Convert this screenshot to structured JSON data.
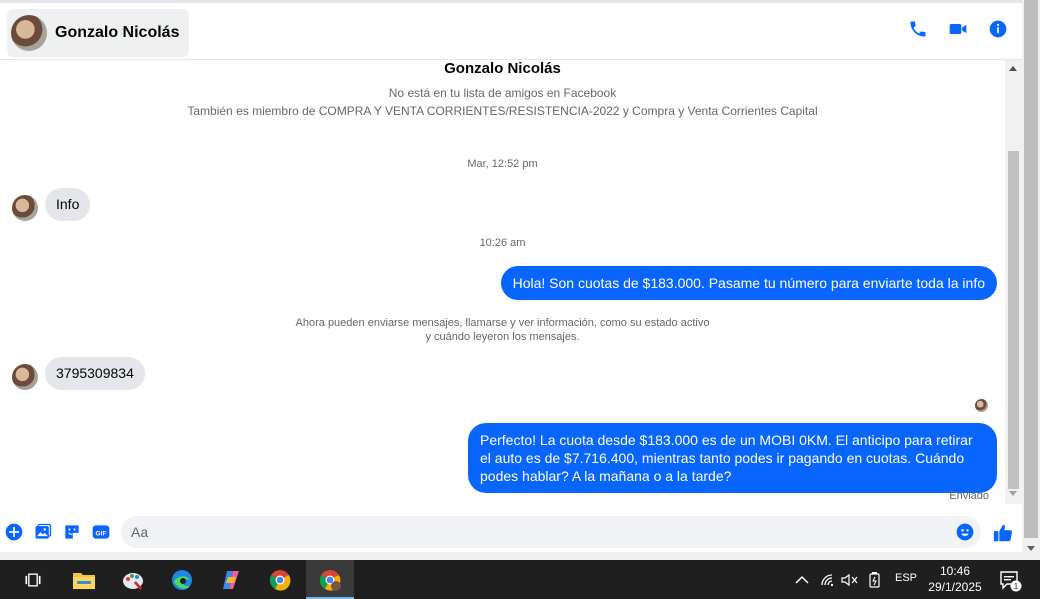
{
  "header": {
    "contact_name": "Gonzalo Nicolás",
    "actions": [
      "phone-icon",
      "video-camera-icon",
      "info-icon"
    ]
  },
  "intro": {
    "name": "Gonzalo Nicolás",
    "line1": "No está en tu lista de amigos en Facebook",
    "line2": "También es miembro de COMPRA Y VENTA CORRIENTES/RESISTENCIA-2022 y Compra y Venta Corrientes Capital"
  },
  "messages": {
    "ts1": "Mar, 12:52 pm",
    "msg_in_1": "Info",
    "ts2": "10:26 am",
    "msg_out_1": "Hola! Son cuotas de $183.000. Pasame tu número para enviarte toda la info",
    "notice_line1": "Ahora pueden enviarse mensajes, llamarse y ver información, como su estado activo",
    "notice_line2": "y cuándo leyeron los mensajes.",
    "msg_in_2": "3795309834",
    "msg_out_2": "Perfecto! La cuota desde $183.000 es de un MOBI 0KM. El anticipo para retirar el auto es de $7.716.400, mientras tanto podes ir pagando en cuotas. Cuándo podes hablar? A la mañana o a la tarde?",
    "status": "Enviado"
  },
  "composer": {
    "placeholder": "Aa",
    "tools": [
      "add-icon",
      "photo-icon",
      "sticker-icon",
      "gif-icon"
    ],
    "gif_label": "GIF"
  },
  "taskbar": {
    "language": "ESP",
    "time": "10:46",
    "date": "29/1/2025",
    "notification_count": "1"
  },
  "colors": {
    "accent": "#0866ff",
    "incoming_bubble": "#e4e6eb",
    "taskbar": "#1f1f1f"
  }
}
